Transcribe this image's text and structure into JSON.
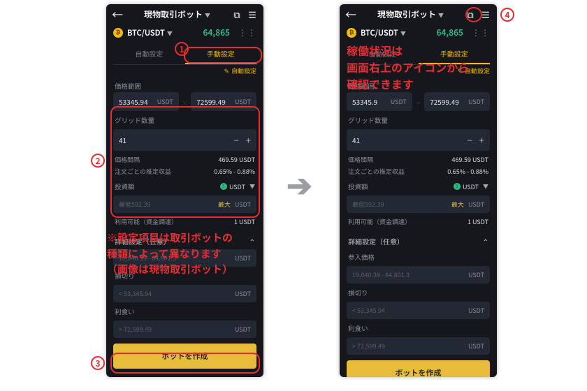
{
  "header": {
    "title": "現物取引ボット"
  },
  "pair": {
    "symbol": "BTC/USDT",
    "price": "64,865"
  },
  "tabs": {
    "auto": "自動設定",
    "manual": "手動設定"
  },
  "autoedit": "自動設定",
  "labels": {
    "price_range": "価格範囲",
    "grid_qty": "グリッド数量",
    "price_gap": "価格間隔",
    "per_order": "注文ごとの推定収益",
    "investment": "投資額",
    "avail": "利用可能（資金調達）",
    "advanced": "詳細設定（任意）",
    "entry": "参入価格",
    "stoploss": "損切り",
    "takeprofit": "利食い"
  },
  "range": {
    "low": "53345.94",
    "high": "72599.49",
    "left_low": "53345.9",
    "unit": "USDT"
  },
  "grid": {
    "value": "41"
  },
  "calc": {
    "gap": "469.59 USDT",
    "per_order": "0.65% - 0.88%"
  },
  "invest": {
    "currency": "USDT",
    "placeholder": "最低592.39",
    "max": "最大",
    "avail": "1 USDT"
  },
  "adv": {
    "entry_ph": "19,040.39 - 64,801.3",
    "sl_ph": "< 53,345.94",
    "tp_ph": "> 72,599.49",
    "unit": "USDT"
  },
  "cta": "ボットを作成",
  "anno": {
    "note1_l1": "※設定項目は取引ボットの",
    "note1_l2": "種類によって異なります",
    "note1_l3": "（画像は現物取引ボット）",
    "note2_l1": "稼働状況は",
    "note2_l2": "画面右上のアイコンから",
    "note2_l3": "確認できます",
    "n1": "1",
    "n2": "2",
    "n3": "3",
    "n4": "4"
  }
}
